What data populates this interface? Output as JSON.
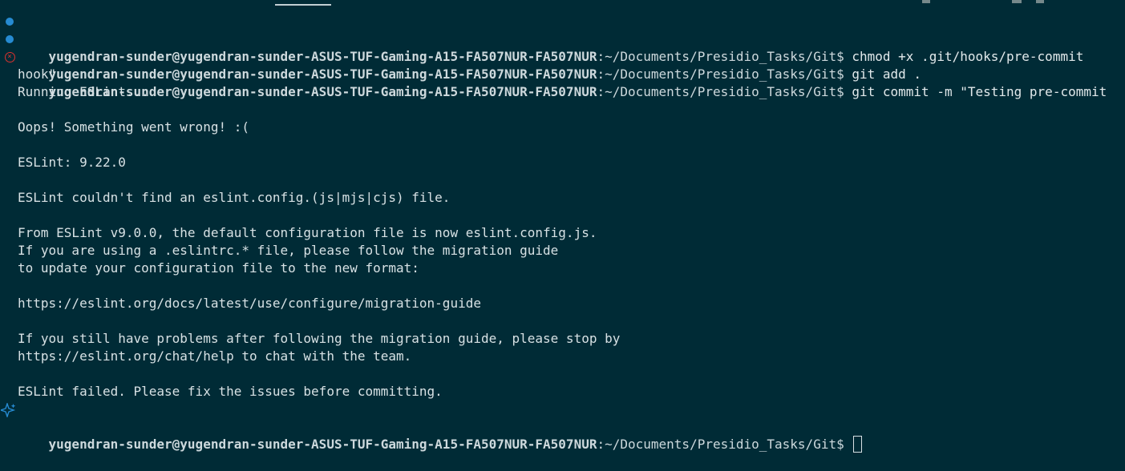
{
  "terminal": {
    "prompt": {
      "user_host": "yugendran-sunder@yugendran-sunder-ASUS-TUF-Gaming-A15-FA507NUR-FA507NUR",
      "path": ":~/Documents/Presidio_Tasks/Git$"
    },
    "commands": {
      "cmd1": "chmod +x .git/hooks/pre-commit",
      "cmd2": "git add .",
      "cmd3": "git commit -m \"Testing pre-commit",
      "cmd3_cont": "hook\""
    },
    "output": [
      "Running ESLint...",
      "",
      "Oops! Something went wrong! :(",
      "",
      "ESLint: 9.22.0",
      "",
      "ESLint couldn't find an eslint.config.(js|mjs|cjs) file.",
      "",
      "From ESLint v9.0.0, the default configuration file is now eslint.config.js.",
      "If you are using a .eslintrc.* file, please follow the migration guide",
      "to update your configuration file to the new format:",
      "",
      "https://eslint.org/docs/latest/use/configure/migration-guide",
      "",
      "If you still have problems after following the migration guide, please stop by",
      "https://eslint.org/chat/help to chat with the team.",
      "",
      "ESLint failed. Please fix the issues before committing."
    ],
    "colors": {
      "background": "#002b36",
      "foreground": "#d7e1e4",
      "success_marker": "#268bd2",
      "error_marker": "#dc322f"
    },
    "icons": {
      "success": "circle-dot-icon",
      "error": "circle-x-icon",
      "current": "sparkle-icon"
    }
  }
}
